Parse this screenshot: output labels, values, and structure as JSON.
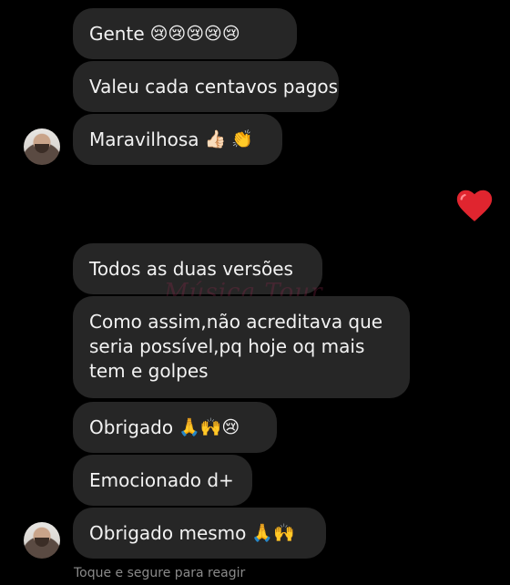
{
  "messages": [
    {
      "text": "Gente",
      "emojis": "😢😢😢😢😢"
    },
    {
      "text": "Valeu cada centavos pagos",
      "emojis": ""
    },
    {
      "text": "Maravilhosa",
      "emojis": "👍🏻 👏"
    },
    {
      "text": "Todos as duas versões",
      "emojis": ""
    },
    {
      "text": "Como assim,não acreditava que seria possível,pq hoje oq mais tem e golpes",
      "emojis": ""
    },
    {
      "text": "Obrigado",
      "emojis": "🙏🙌😢"
    },
    {
      "text": "Emocionado d+",
      "emojis": ""
    },
    {
      "text": "Obrigado mesmo",
      "emojis": "🙏🙌"
    }
  ],
  "reaction": {
    "icon": "heart-icon",
    "color": "#e0252f"
  },
  "watermark": "Música Tour",
  "footer": {
    "hint": "Toque e segure para reagir"
  }
}
